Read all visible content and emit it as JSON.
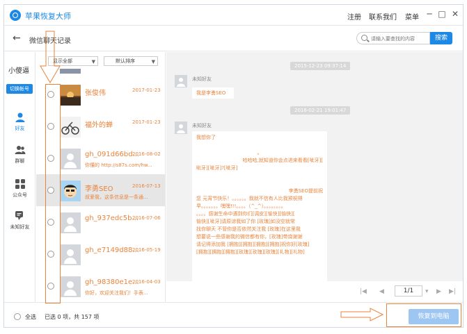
{
  "app": {
    "title": "苹果恢复大师",
    "menu": {
      "register": "注册",
      "contact": "联系我们",
      "menu": "菜单"
    }
  },
  "header": {
    "back_icon": "arrow-left-icon",
    "title": "微信聊天记录",
    "search": {
      "placeholder": "请输入要查找的内容",
      "button": "搜索"
    }
  },
  "sidebar": {
    "user_name": "小傻逼",
    "switch_account": "切换帐号",
    "items": [
      {
        "label": "好友",
        "icon": "person-icon",
        "active": true
      },
      {
        "label": "群聊",
        "icon": "group-icon",
        "active": false
      },
      {
        "label": "公众号",
        "icon": "grid-icon",
        "active": false
      },
      {
        "label": "未知好友",
        "icon": "chat-bubble-icon",
        "active": false
      }
    ]
  },
  "list": {
    "filter": "显示全部",
    "sort": "默认排序",
    "contacts": [
      {
        "name": "张俊伟",
        "date": "2017-01-23",
        "preview": "",
        "avatar": "photo-sunset",
        "selected": false
      },
      {
        "name": "福外的蝉",
        "date": "2017-01-23",
        "preview": "",
        "avatar": "photo-bike",
        "selected": false
      },
      {
        "name": "gh_091d66bd...",
        "date": "2016-08-02",
        "preview": "你懂的  http://s87s.com/hw...",
        "avatar": "generic",
        "selected": false
      },
      {
        "name": "李勇SEO",
        "date": "2016-07-13",
        "preview": "叔爱我，这条信息是一条通...",
        "avatar": "photo-cartoon",
        "selected": true
      },
      {
        "name": "gh_937edc5b...",
        "date": "2016-07-06",
        "preview": "",
        "avatar": "generic",
        "selected": false
      },
      {
        "name": "gh_e7149d88...",
        "date": "2016-05-19",
        "preview": "",
        "avatar": "generic",
        "selected": false
      },
      {
        "name": "gh_98380e1e...",
        "date": "2016-04-03",
        "preview": "你好，欢迎关注我们！手表...",
        "avatar": "generic",
        "selected": false
      }
    ]
  },
  "chat": {
    "messages": [
      {
        "time": "2015-12-23 09:37:14",
        "sender": "未知好友",
        "text": "我是李勇SEO"
      },
      {
        "time": "2016-02-21 19:01:47",
        "sender": "未知好友",
        "lines": [
          "我想你了",
          "",
          "。",
          "哈哈哈,就知道你会点进来看看[呲牙][",
          "呲牙][呲牙]?[呲牙]",
          "",
          "",
          "李勇SEO提前祝",
          "您 元宵节快乐！。。。。。。我就不信有人比我预祝得",
          "早。。。。。。。嘿嘿!!!。。。。（^_^）。。。。。。。。",
          "。。。。感谢生命中遇到你们[调皮][愉快][愉快][",
          "愉快][呲牙]请原谅我如了你  [玫瑰]如没空就常",
          "找你聊天  不管你是否依然关注我  [玫瑰]在这里我",
          "想要说一些感谢我的微信都有你，[玫瑰]带烧谢谢",
          "请记得添加我  [拥抱][拥抱][拥抱][拥抱]祝你好[玫瑰]",
          "[拥抱][拥抱][拥抱][玫瑰][玫瑰][玫瑰][礼物][礼物]"
        ]
      }
    ]
  },
  "pagination": {
    "page": "1/1"
  },
  "footer": {
    "select_all": "全选",
    "selected_count": "已选 0 项，共 157 项",
    "restore_button": "恢复到电脑"
  },
  "colors": {
    "accent": "#1e88e5",
    "highlight_text": "#e8833a",
    "selected_row": "#e6e6e6",
    "chat_bg": "#f2f2f2",
    "restore_disabled": "#9dc7f2"
  }
}
